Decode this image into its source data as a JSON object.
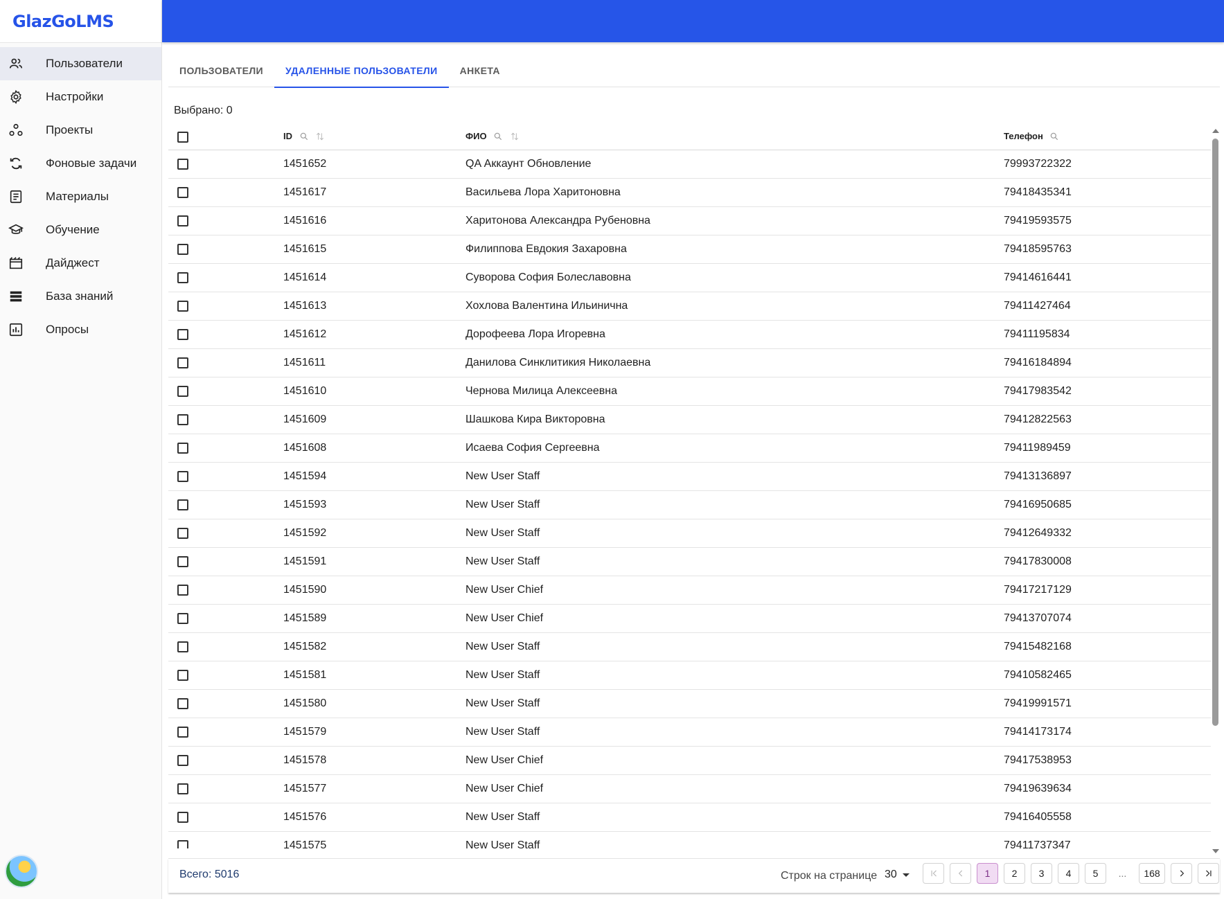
{
  "app": {
    "logo": "GlazGoLMS"
  },
  "sidebar": {
    "items": [
      {
        "label": "Пользователи",
        "icon": "users-icon",
        "active": true
      },
      {
        "label": "Настройки",
        "icon": "gear-icon",
        "active": false
      },
      {
        "label": "Проекты",
        "icon": "projects-icon",
        "active": false
      },
      {
        "label": "Фоновые задачи",
        "icon": "sync-icon",
        "active": false
      },
      {
        "label": "Материалы",
        "icon": "document-icon",
        "active": false
      },
      {
        "label": "Обучение",
        "icon": "graduation-cap-icon",
        "active": false
      },
      {
        "label": "Дайджест",
        "icon": "digest-icon",
        "active": false
      },
      {
        "label": "База знаний",
        "icon": "storage-icon",
        "active": false
      },
      {
        "label": "Опросы",
        "icon": "poll-icon",
        "active": false
      }
    ]
  },
  "tabs": [
    {
      "label": "ПОЛЬЗОВАТЕЛИ",
      "active": false
    },
    {
      "label": "УДАЛЕННЫЕ ПОЛЬЗОВАТЕЛИ",
      "active": true
    },
    {
      "label": "АНКЕТА",
      "active": false
    }
  ],
  "selection": {
    "text": "Выбрано: 0"
  },
  "table": {
    "columns": {
      "id": "ID",
      "name": "ФИО",
      "phone": "Телефон"
    },
    "rows": [
      {
        "id": "1451652",
        "name": "QA Аккаунт Обновление",
        "phone": "79993722322"
      },
      {
        "id": "1451617",
        "name": "Васильева Лора Харитоновна",
        "phone": "79418435341"
      },
      {
        "id": "1451616",
        "name": "Харитонова Александра Рубеновна",
        "phone": "79419593575"
      },
      {
        "id": "1451615",
        "name": "Филиппова Евдокия Захаровна",
        "phone": "79418595763"
      },
      {
        "id": "1451614",
        "name": "Суворова София Болеславовна",
        "phone": "79414616441"
      },
      {
        "id": "1451613",
        "name": "Хохлова Валентина Ильинична",
        "phone": "79411427464"
      },
      {
        "id": "1451612",
        "name": "Дорофеева Лора Игоревна",
        "phone": "79411195834"
      },
      {
        "id": "1451611",
        "name": "Данилова Синклитикия Николаевна",
        "phone": "79416184894"
      },
      {
        "id": "1451610",
        "name": "Чернова Милица Алексеевна",
        "phone": "79417983542"
      },
      {
        "id": "1451609",
        "name": "Шашкова Кира Викторовна",
        "phone": "79412822563"
      },
      {
        "id": "1451608",
        "name": "Исаева София Сергеевна",
        "phone": "79411989459"
      },
      {
        "id": "1451594",
        "name": "New User Staff",
        "phone": "79413136897"
      },
      {
        "id": "1451593",
        "name": "New User Staff",
        "phone": "79416950685"
      },
      {
        "id": "1451592",
        "name": "New User Staff",
        "phone": "79412649332"
      },
      {
        "id": "1451591",
        "name": "New User Staff",
        "phone": "79417830008"
      },
      {
        "id": "1451590",
        "name": "New User Chief",
        "phone": "79417217129"
      },
      {
        "id": "1451589",
        "name": "New User Chief",
        "phone": "79413707074"
      },
      {
        "id": "1451582",
        "name": "New User Staff",
        "phone": "79415482168"
      },
      {
        "id": "1451581",
        "name": "New User Staff",
        "phone": "79410582465"
      },
      {
        "id": "1451580",
        "name": "New User Staff",
        "phone": "79419991571"
      },
      {
        "id": "1451579",
        "name": "New User Staff",
        "phone": "79414173174"
      },
      {
        "id": "1451578",
        "name": "New User Chief",
        "phone": "79417538953"
      },
      {
        "id": "1451577",
        "name": "New User Chief",
        "phone": "79419639634"
      },
      {
        "id": "1451576",
        "name": "New User Staff",
        "phone": "79416405558"
      },
      {
        "id": "1451575",
        "name": "New User Staff",
        "phone": "79411737347"
      }
    ]
  },
  "footer": {
    "total": "Всего: 5016",
    "rows_per_page_label": "Строк на странице",
    "rows_per_page_value": "30",
    "pages": [
      "1",
      "2",
      "3",
      "4",
      "5"
    ],
    "current_page": "1",
    "ellipsis": "...",
    "last_page": "168"
  },
  "colors": {
    "accent": "#2653e8",
    "topbar": "#2655e8",
    "active_page": "#f1dcf3"
  }
}
